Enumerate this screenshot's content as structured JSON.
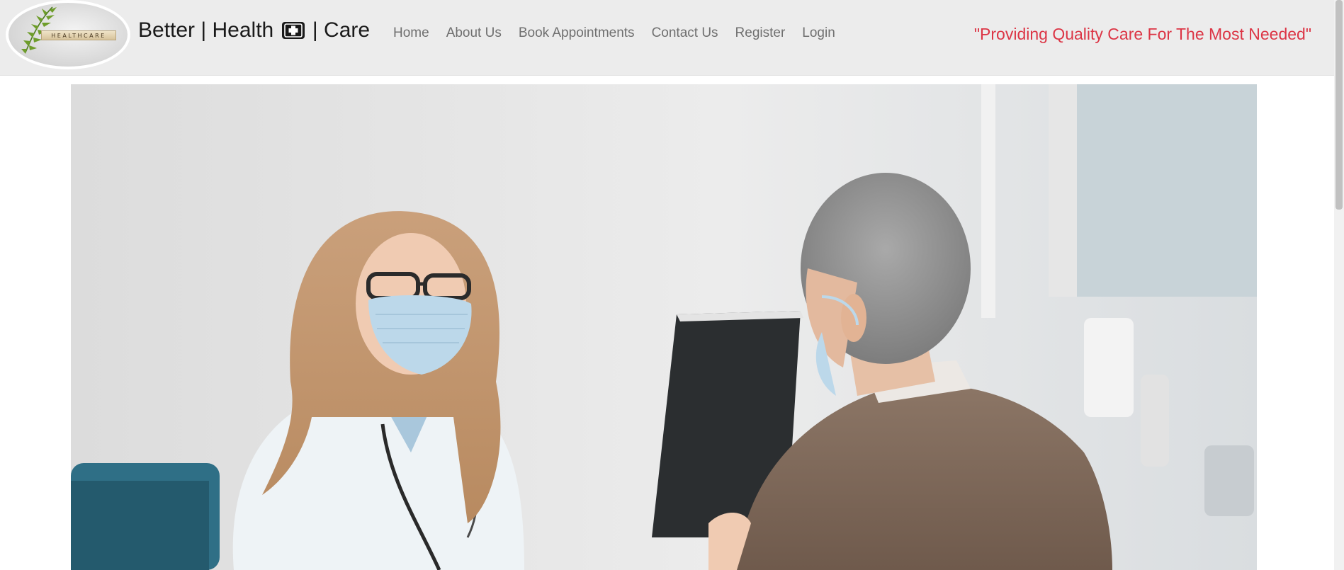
{
  "logo": {
    "label": "HEALTHCARE",
    "icon": "fern-leaf-icon"
  },
  "brand": {
    "part1": "Better | Health",
    "part2": "| Care",
    "icon": "medical-kit-icon"
  },
  "nav": {
    "items": [
      {
        "label": "Home"
      },
      {
        "label": "About Us"
      },
      {
        "label": "Book Appointments"
      },
      {
        "label": "Contact Us"
      },
      {
        "label": "Register"
      },
      {
        "label": "Login"
      }
    ]
  },
  "tagline": "\"Providing Quality Care For The Most Needed\"",
  "hero": {
    "scene": "doctor-consulting-patient"
  },
  "colors": {
    "navbar_bg": "#ececec",
    "tagline": "#dc3545",
    "nav_link": "#6f6f6f",
    "brand": "#1a1a1a"
  }
}
